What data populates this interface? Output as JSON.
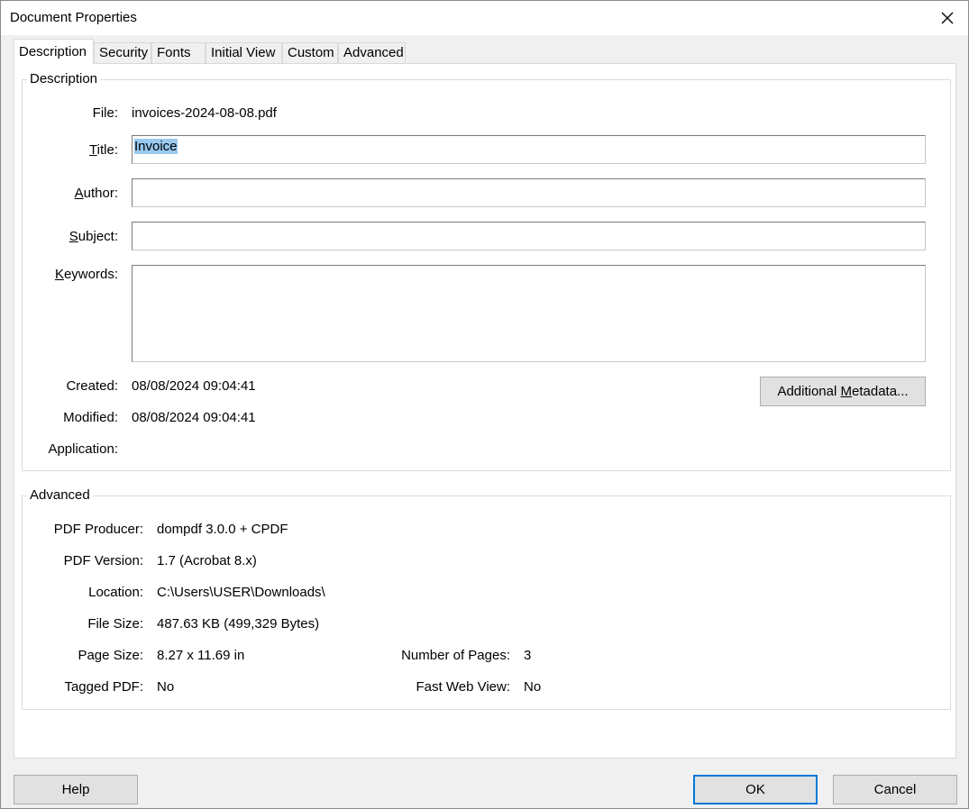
{
  "window": {
    "title": "Document Properties"
  },
  "tabs": [
    {
      "label": "Description"
    },
    {
      "label": "Security"
    },
    {
      "label": "Fonts"
    },
    {
      "label": "Initial View"
    },
    {
      "label": "Custom"
    },
    {
      "label": "Advanced"
    }
  ],
  "description": {
    "legend": "Description",
    "file_label": "File:",
    "file_value": "invoices-2024-08-08.pdf",
    "title_label": "Title:",
    "title_value": "Invoice",
    "author_label": "Author:",
    "author_value": "",
    "subject_label": "Subject:",
    "subject_value": "",
    "keywords_label": "Keywords:",
    "keywords_value": "",
    "created_label": "Created:",
    "created_value": "08/08/2024 09:04:41",
    "modified_label": "Modified:",
    "modified_value": "08/08/2024 09:04:41",
    "application_label": "Application:",
    "application_value": "",
    "metadata_button": "Additional Metadata..."
  },
  "advanced": {
    "legend": "Advanced",
    "producer_label": "PDF Producer:",
    "producer_value": "dompdf 3.0.0 + CPDF",
    "version_label": "PDF Version:",
    "version_value": "1.7 (Acrobat 8.x)",
    "location_label": "Location:",
    "location_value": "C:\\Users\\USER\\Downloads\\",
    "filesize_label": "File Size:",
    "filesize_value": "487.63 KB (499,329 Bytes)",
    "pagesize_label": "Page Size:",
    "pagesize_value": "8.27 x 11.69 in",
    "numpages_label": "Number of Pages:",
    "numpages_value": "3",
    "tagged_label": "Tagged PDF:",
    "tagged_value": "No",
    "fastweb_label": "Fast Web View:",
    "fastweb_value": "No"
  },
  "buttons": {
    "help": "Help",
    "ok": "OK",
    "cancel": "Cancel"
  },
  "icons": {
    "close": "close-icon"
  },
  "colors": {
    "selection": "#99c9ef",
    "default_button_border": "#0078d7"
  }
}
